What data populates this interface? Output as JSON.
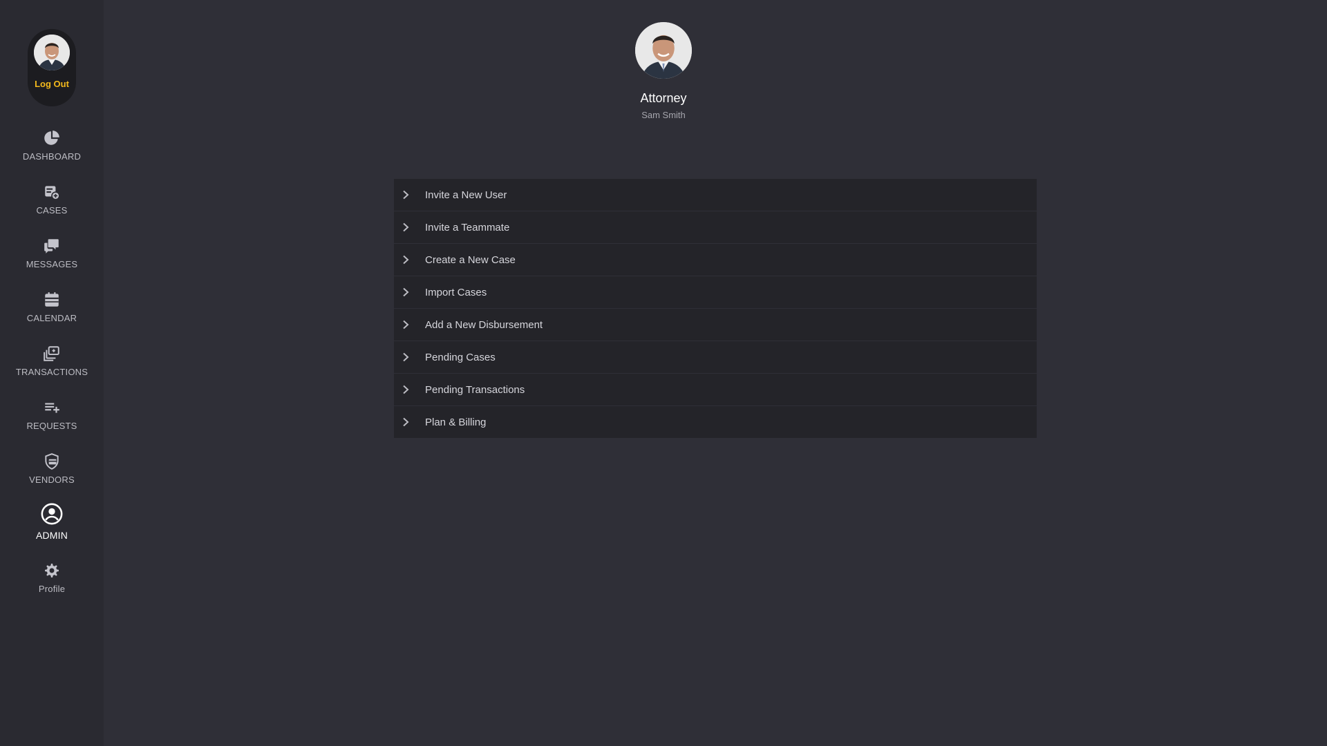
{
  "user": {
    "logout_label": "Log Out",
    "role": "Attorney",
    "name": "Sam Smith"
  },
  "sidebar": {
    "items": [
      {
        "label": "DASHBOARD",
        "icon": "pie-chart-icon"
      },
      {
        "label": "CASES",
        "icon": "cases-icon"
      },
      {
        "label": "MESSAGES",
        "icon": "chat-bubbles-icon"
      },
      {
        "label": "CALENDAR",
        "icon": "calendar-icon"
      },
      {
        "label": "TRANSACTIONS",
        "icon": "transactions-icon"
      },
      {
        "label": "REQUESTS",
        "icon": "playlist-add-icon"
      },
      {
        "label": "VENDORS",
        "icon": "vendors-icon"
      },
      {
        "label": "ADMIN",
        "icon": "account-circle-icon",
        "active": true
      },
      {
        "label": "Profile",
        "icon": "gear-icon"
      }
    ]
  },
  "menu": {
    "items": [
      {
        "label": "Invite a New User"
      },
      {
        "label": "Invite a Teammate"
      },
      {
        "label": "Create a New Case"
      },
      {
        "label": "Import Cases"
      },
      {
        "label": "Add a New Disbursement"
      },
      {
        "label": "Pending Cases"
      },
      {
        "label": "Pending Transactions"
      },
      {
        "label": "Plan & Billing"
      }
    ]
  },
  "colors": {
    "background": "#2f2f37",
    "sidebar": "#2a2a31",
    "row": "#242429",
    "accent": "#f3b91c"
  }
}
